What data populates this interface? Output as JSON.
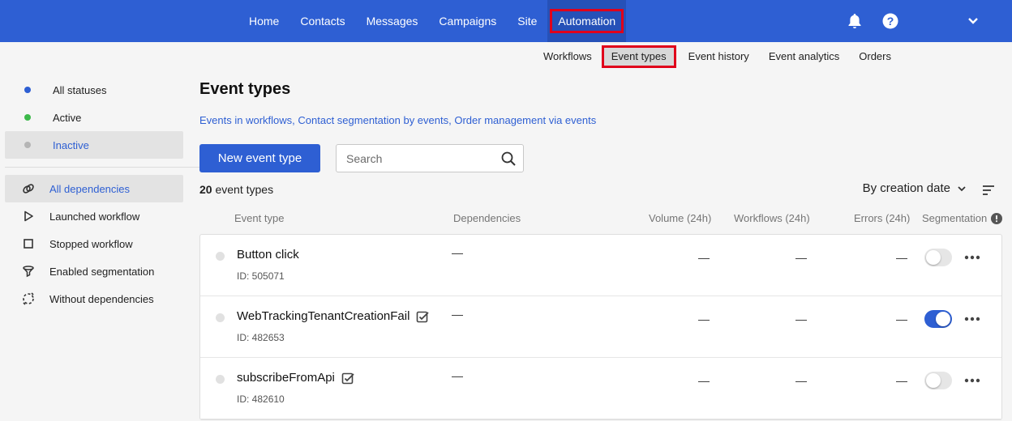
{
  "topnav": {
    "items": [
      "Home",
      "Contacts",
      "Messages",
      "Campaigns",
      "Site",
      "Automation"
    ],
    "active": "Automation"
  },
  "subnav": {
    "items": [
      "Workflows",
      "Event types",
      "Event history",
      "Event analytics",
      "Orders"
    ],
    "active": "Event types"
  },
  "sidebar": {
    "statuses": [
      {
        "label": "All statuses",
        "color": "#2e5fd3"
      },
      {
        "label": "Active",
        "color": "#3cb94a"
      },
      {
        "label": "Inactive",
        "color": "#b5b5b5"
      }
    ],
    "dependencies": [
      {
        "label": "All dependencies",
        "icon": "link-icon"
      },
      {
        "label": "Launched workflow",
        "icon": "play-icon"
      },
      {
        "label": "Stopped workflow",
        "icon": "stop-icon"
      },
      {
        "label": "Enabled segmentation",
        "icon": "filter-icon"
      },
      {
        "label": "Without dependencies",
        "icon": "unlink-icon"
      }
    ]
  },
  "main": {
    "title": "Event types",
    "links": [
      "Events in workflows",
      "Contact segmentation by events",
      "Order management via events"
    ],
    "new_button": "New event type",
    "search_placeholder": "Search",
    "count_number": "20",
    "count_label": "event types",
    "sort_label": "By creation date"
  },
  "table": {
    "columns": [
      "Event type",
      "Dependencies",
      "Volume (24h)",
      "Workflows (24h)",
      "Errors (24h)",
      "Segmentation"
    ],
    "rows": [
      {
        "name": "Button click",
        "id": "ID: 505071",
        "checked_icon": false,
        "dependencies": "—",
        "volume": "—",
        "workflows": "—",
        "errors": "—",
        "segmentation": false
      },
      {
        "name": "WebTrackingTenantCreationFail",
        "id": "ID: 482653",
        "checked_icon": true,
        "dependencies": "—",
        "volume": "—",
        "workflows": "—",
        "errors": "—",
        "segmentation": true
      },
      {
        "name": "subscribeFromApi",
        "id": "ID: 482610",
        "checked_icon": true,
        "dependencies": "—",
        "volume": "—",
        "workflows": "—",
        "errors": "—",
        "segmentation": false
      }
    ]
  }
}
